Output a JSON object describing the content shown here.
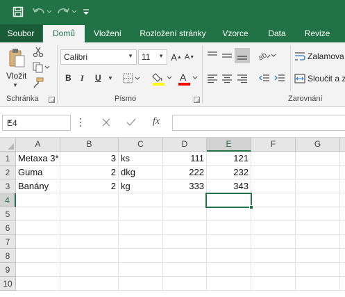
{
  "qat": {
    "icons": [
      "save-icon",
      "undo-icon",
      "redo-icon",
      "customize-qat-icon"
    ]
  },
  "tabs": [
    {
      "label": "Soubor"
    },
    {
      "label": "Domů"
    },
    {
      "label": "Vložení"
    },
    {
      "label": "Rozložení stránky"
    },
    {
      "label": "Vzorce"
    },
    {
      "label": "Data"
    },
    {
      "label": "Revize"
    }
  ],
  "ribbon": {
    "clipboard": {
      "paste_label": "Vložit",
      "group_label": "Schránka"
    },
    "font": {
      "font_name": "Calibri",
      "font_size": "11",
      "bold": "B",
      "italic": "I",
      "underline": "U",
      "group_label": "Písmo",
      "fill_color": "#ffff00",
      "font_color": "#ff0000"
    },
    "alignment": {
      "wrap_text": "Zalamova",
      "merge_center": "Sloučit a z",
      "group_label": "Zarovnání"
    }
  },
  "formula_bar": {
    "name_box": "E4",
    "fx": "fx",
    "formula": ""
  },
  "sheet": {
    "columns": [
      "A",
      "B",
      "C",
      "D",
      "E",
      "F",
      "G"
    ],
    "rows": [
      "1",
      "2",
      "3",
      "4",
      "5",
      "6",
      "7",
      "8",
      "9",
      "10"
    ],
    "cells": [
      {
        "A": "Metaxa 3*",
        "B": "3",
        "C": "ks",
        "D": "111",
        "E": "121"
      },
      {
        "A": "Guma",
        "B": "2",
        "C": "dkg",
        "D": "222",
        "E": "232"
      },
      {
        "A": "Banány",
        "B": "2",
        "C": "kg",
        "D": "333",
        "E": "343"
      }
    ],
    "active_cell": "E4",
    "accent": "#217346"
  }
}
